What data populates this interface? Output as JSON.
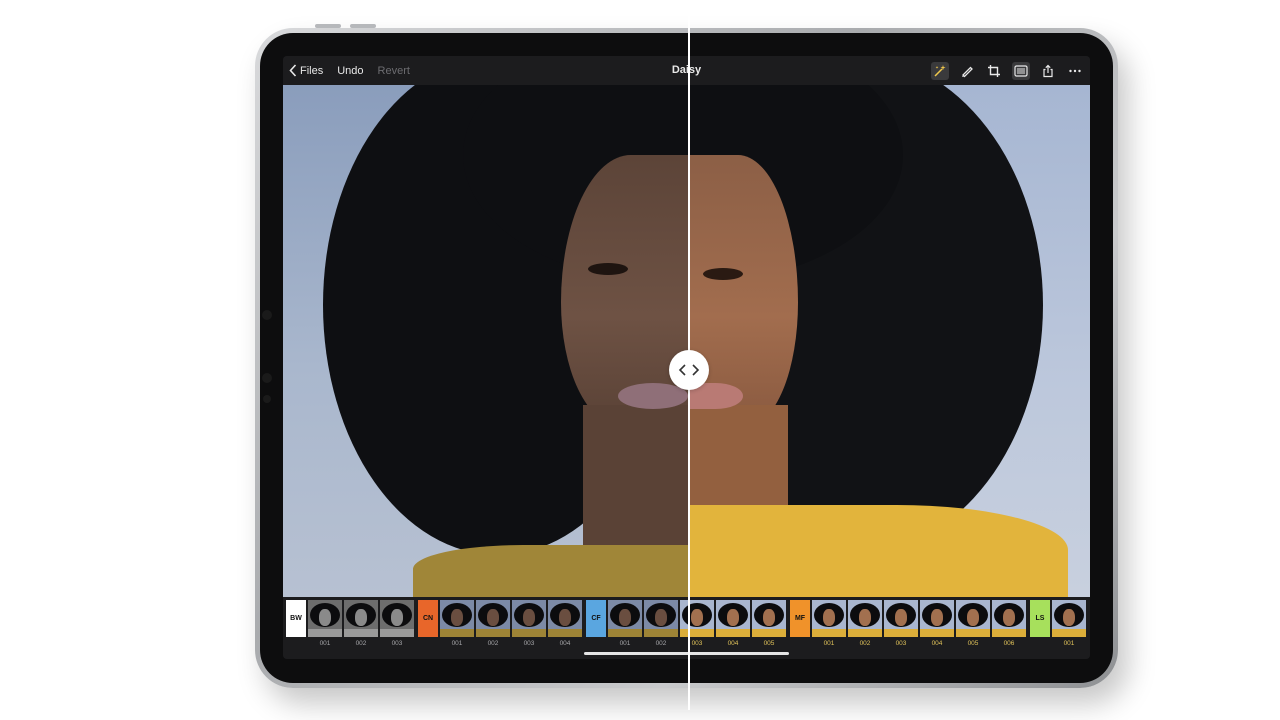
{
  "toolbar": {
    "back_label": "Files",
    "undo_label": "Undo",
    "revert_label": "Revert",
    "title": "Daisy",
    "icons": [
      "auto-enhance-icon",
      "brush-icon",
      "crop-icon",
      "sliders-icon",
      "share-icon",
      "more-icon"
    ]
  },
  "colors": {
    "toolbar_bg": "#1c1c1e",
    "bw": "#ffffff",
    "cn": "#e8662a",
    "cf": "#5aa6e0",
    "mf": "#f0922a",
    "ls": "#a7e05c",
    "after_label": "#e0c25a",
    "before_label": "#a5a5a8"
  },
  "filmstrip": {
    "groups": [
      {
        "tag": "BW",
        "items": [
          "001",
          "002",
          "003"
        ]
      },
      {
        "tag": "CN",
        "items": [
          "001",
          "002",
          "003",
          "004"
        ]
      },
      {
        "tag": "CF",
        "items": [
          "001",
          "002",
          "003",
          "004",
          "005"
        ]
      },
      {
        "tag": "MF",
        "items": [
          "001",
          "002",
          "003",
          "004",
          "005",
          "006"
        ]
      },
      {
        "tag": "LS",
        "items": [
          "001"
        ]
      }
    ]
  }
}
